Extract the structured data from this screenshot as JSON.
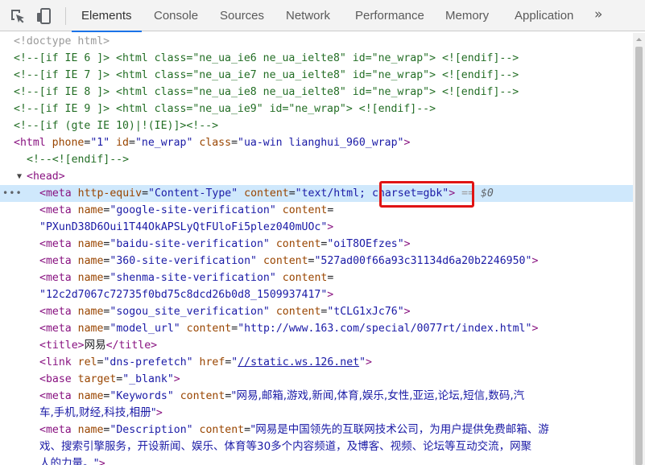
{
  "toolbar": {
    "tabs": [
      {
        "label": "Elements",
        "active": true
      },
      {
        "label": "Console",
        "active": false
      },
      {
        "label": "Sources",
        "active": false
      },
      {
        "label": "Network",
        "active": false
      },
      {
        "label": "Performance",
        "active": false
      },
      {
        "label": "Memory",
        "active": false
      },
      {
        "label": "Application",
        "active": false
      }
    ],
    "more": "»",
    "icons": [
      "inspect-element-icon",
      "device-toolbar-icon"
    ]
  },
  "tree": {
    "doctype": "<!doctype html>",
    "ie6_open": "<!--[if IE 6 ]> ",
    "ie6_html": "<html class=\"ne_ua_ie6 ne_ua_ielte8\" id=\"ne_wrap\">",
    "ie6_close": " <![endif]-->",
    "ie7_open": "<!--[if IE 7 ]> ",
    "ie7_html": "<html class=\"ne_ua_ie7 ne_ua_ielte8\" id=\"ne_wrap\">",
    "ie7_close": " <![endif]-->",
    "ie8_open": "<!--[if IE 8 ]> ",
    "ie8_html": "<html class=\"ne_ua_ie8 ne_ua_ielte8\" id=\"ne_wrap\">",
    "ie8_close": " <![endif]-->",
    "ie9_open": "<!--[if IE 9 ]> ",
    "ie9_html": "<html class=\"ne_ua_ie9\" id=\"ne_wrap\">",
    "ie9_close": " <![endif]-->",
    "gte_ie10": "<!--[if (gte IE 10)|!(IE)]><!-->",
    "html_tag": {
      "open": "<html",
      "a1": "phone",
      "v1": "\"1\"",
      "a2": "id",
      "v2": "\"ne_wrap\"",
      "a3": "class",
      "v3": "\"ua-win lianghui_960_wrap\"",
      "close": ">"
    },
    "endif": "<!--<![endif]-->",
    "head_open": "<head>",
    "meta_selected": {
      "open": "<meta",
      "a1": "http-equiv",
      "v1": "\"Content-Type\"",
      "a2": "content",
      "v2_part1": "\"text/html;",
      "v2_part2": "charset=gbk\"",
      "close": ">",
      "marker": " == ",
      "var": "$0"
    },
    "meta_google": {
      "open": "<meta",
      "a1": "name",
      "v1": "\"google-site-verification\"",
      "a2": "content",
      "v2": "\"PXunD38D6Oui1T44OkAPSLyQtFUloFi5plez040mUOc\"",
      "close": ">"
    },
    "meta_baidu": {
      "open": "<meta",
      "a1": "name",
      "v1": "\"baidu-site-verification\"",
      "a2": "content",
      "v2": "\"oiT8OEfzes\"",
      "close": ">"
    },
    "meta_360": {
      "open": "<meta",
      "a1": "name",
      "v1": "\"360-site-verification\"",
      "a2": "content",
      "v2": "\"527ad00f66a93c31134d6a20b2246950\"",
      "close": ">"
    },
    "meta_shenma": {
      "open": "<meta",
      "a1": "name",
      "v1": "\"shenma-site-verification\"",
      "a2": "content",
      "v2": "\"12c2d7067c72735f0bd75c8dcd26b0d8_1509937417\"",
      "close": ">"
    },
    "meta_sogou": {
      "open": "<meta",
      "a1": "name",
      "v1": "\"sogou_site_verification\"",
      "a2": "content",
      "v2": "\"tCLG1xJc76\"",
      "close": ">"
    },
    "meta_model": {
      "open": "<meta",
      "a1": "name",
      "v1": "\"model_url\"",
      "a2": "content",
      "v2": "\"http://www.163.com/special/0077rt/index.html\"",
      "close": ">"
    },
    "title": {
      "open": "<title>",
      "text": "网易",
      "close": "</title>"
    },
    "link": {
      "open": "<link",
      "a1": "rel",
      "v1": "\"dns-prefetch\"",
      "a2": "href",
      "q_open": "\"",
      "href": "//static.ws.126.net",
      "q_close": "\"",
      "close": ">"
    },
    "base": {
      "open": "<base",
      "a1": "target",
      "v1": "\"_blank\"",
      "close": ">"
    },
    "meta_keywords": {
      "open": "<meta",
      "a1": "name",
      "v1": "\"Keywords\"",
      "a2": "content",
      "v2_line1": "\"网易,邮箱,游戏,新闻,体育,娱乐,女性,亚运,论坛,短信,数码,汽",
      "v2_line2": "车,手机,财经,科技,相册\"",
      "close": ">"
    },
    "meta_description": {
      "open": "<meta",
      "a1": "name",
      "v1": "\"Description\"",
      "a2": "content",
      "v2_line1": "\"网易是中国领先的互联网技术公司，为用户提供免费邮箱、游",
      "v2_line2": "戏、搜索引擎服务，开设新闻、娱乐、体育等30多个内容频道，及博客、视频、论坛等互动交流，网聚",
      "v2_line3": "人的力量。\"",
      "close": ">"
    }
  },
  "colors": {
    "tag": "#881280",
    "attribute": "#994500",
    "value": "#1a1aa6",
    "comment": "#236e25",
    "selection": "#cfe8fc",
    "highlight_box": "#e01414",
    "active_tab_underline": "#1a73e8"
  }
}
